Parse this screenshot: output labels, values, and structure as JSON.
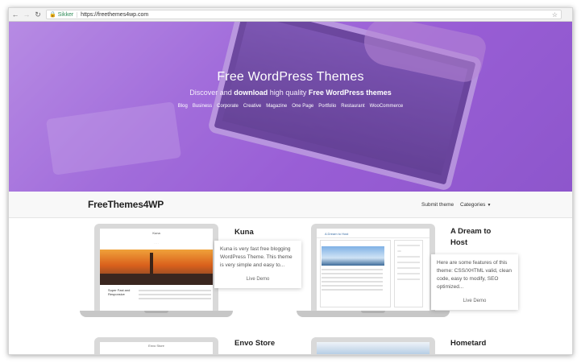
{
  "browser": {
    "secure_label": "Sikker",
    "url": "https://freethemes4wp.com",
    "back_icon": "back-arrow-icon",
    "forward_icon": "forward-arrow-icon",
    "reload_icon": "reload-icon",
    "bookmark_icon": "star-icon"
  },
  "hero": {
    "title": "Free WordPress Themes",
    "subtitle_prefix": "Discover and ",
    "subtitle_bold1": "download",
    "subtitle_mid": " high quality ",
    "subtitle_bold2": "Free WordPress themes",
    "tags": [
      "Blog",
      "Business",
      "Corporate",
      "Creative",
      "Magazine",
      "One Page",
      "Portfolio",
      "Restaurant",
      "WooCommerce"
    ]
  },
  "nav": {
    "brand": "FreeThemes4WP",
    "submit": "Submit theme",
    "categories": "Categories"
  },
  "themes": [
    {
      "title": "Kuna",
      "description": "Kuna is very fast free blogging WordPress Theme. This theme is very simple and easy to...",
      "demo": "Live Demo",
      "preview": {
        "site_title": "Kuna",
        "post_title": "Super Fast and Responsive"
      }
    },
    {
      "title": "A Dream to Host",
      "description": "Here are some features of this theme: CSS/XHTML valid, clean code, easy to modify, SEO optimized...",
      "demo": "Live Demo",
      "preview": {
        "site_title": "A Dream to Host"
      }
    },
    {
      "title": "Envo Store",
      "preview": {
        "site_title": "Envo Store"
      }
    },
    {
      "title": "Hometard"
    }
  ],
  "colors": {
    "hero_accent": "#9b61d8",
    "secure_green": "#2e8b57",
    "brand_text": "#222222"
  }
}
